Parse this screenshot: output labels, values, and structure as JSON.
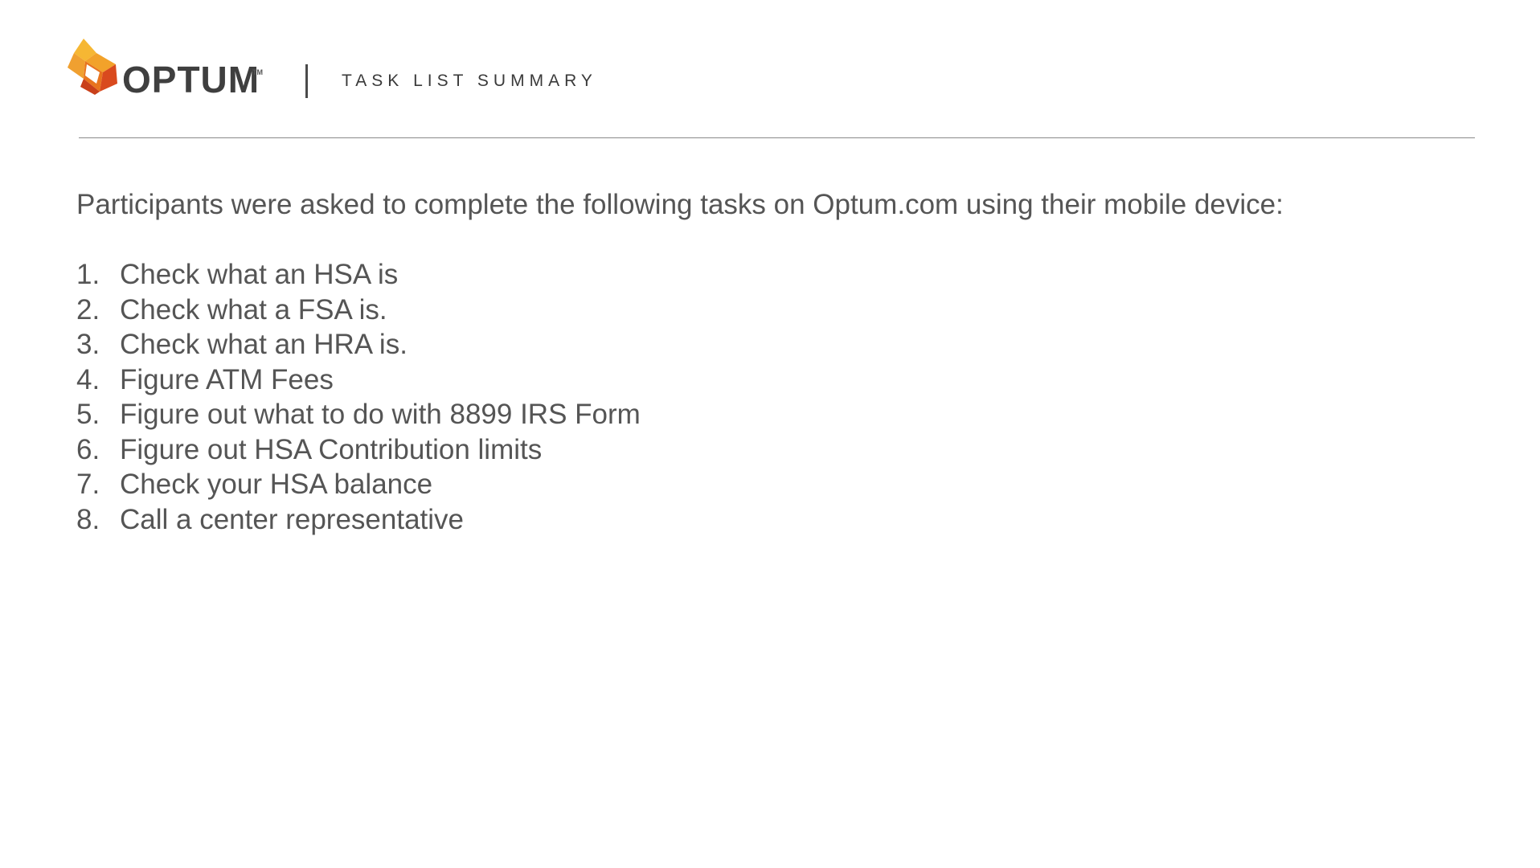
{
  "header": {
    "logo_text": "OPTUM",
    "logo_tm": "TM",
    "title": "TASK LIST SUMMARY"
  },
  "colors": {
    "logo_orange": "#f2a22a",
    "logo_dark_orange": "#e8741e",
    "logo_red": "#d94a1e",
    "text": "#555555"
  },
  "intro": "Participants were asked to complete the following tasks on Optum.com using their mobile device:",
  "tasks": [
    {
      "num": "1.",
      "text": "Check what an HSA is"
    },
    {
      "num": "2.",
      "text": "Check what a FSA is."
    },
    {
      "num": "3.",
      "text": "Check what an HRA is."
    },
    {
      "num": "4.",
      "text": "Figure ATM Fees"
    },
    {
      "num": "5.",
      "text": "Figure out what to do with 8899 IRS Form"
    },
    {
      "num": "6.",
      "text": "Figure out HSA Contribution limits"
    },
    {
      "num": "7.",
      "text": "Check your HSA balance"
    },
    {
      "num": "8.",
      "text": "Call a center representative"
    }
  ]
}
